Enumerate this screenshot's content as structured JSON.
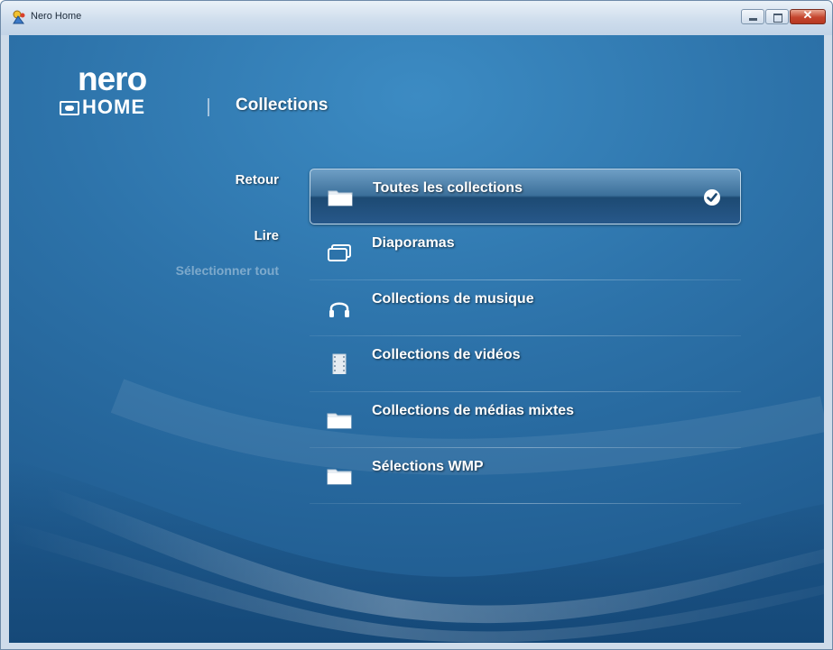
{
  "window": {
    "title": "Nero Home"
  },
  "header": {
    "logo_top": "nero",
    "logo_bottom": "HOME",
    "page_title": "Collections"
  },
  "actions": [
    {
      "label": "Retour",
      "enabled": true
    },
    {
      "label": "Lire",
      "enabled": true
    },
    {
      "label": "Sélectionner tout",
      "enabled": false
    }
  ],
  "collections": [
    {
      "label": "Toutes les collections",
      "icon": "folder-icon",
      "selected": true
    },
    {
      "label": "Diaporamas",
      "icon": "slideshow-icon",
      "selected": false
    },
    {
      "label": "Collections de musique",
      "icon": "headphones-icon",
      "selected": false
    },
    {
      "label": "Collections de vidéos",
      "icon": "film-icon",
      "selected": false
    },
    {
      "label": "Collections de médias mixtes",
      "icon": "folder-icon",
      "selected": false
    },
    {
      "label": "Sélections WMP",
      "icon": "folder-icon",
      "selected": false
    }
  ],
  "colors": {
    "background": "#2d73aa",
    "selection": "#27588a",
    "text": "#ffffff"
  }
}
